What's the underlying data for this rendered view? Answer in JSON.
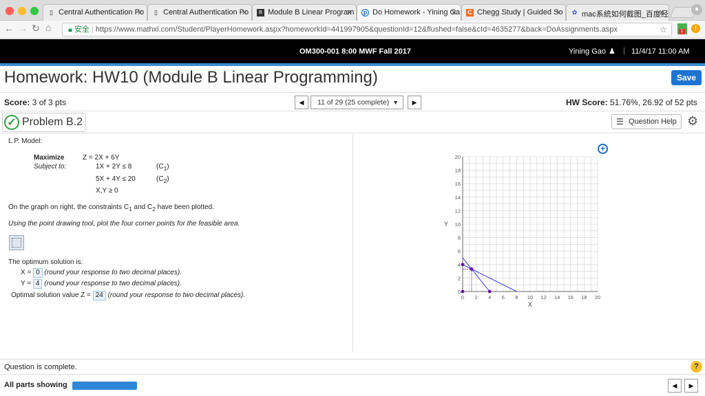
{
  "browser": {
    "tabs": [
      {
        "label": "Central Authentication Po",
        "icon": "page-icon"
      },
      {
        "label": "Central Authentication Po",
        "icon": "page-icon"
      },
      {
        "label": "Module B Linear Program",
        "icon": "module-icon"
      },
      {
        "label": "Do Homework - Yining Ga",
        "icon": "pearson-icon"
      },
      {
        "label": "Chegg Study | Guided So",
        "icon": "chegg-icon"
      },
      {
        "label": "mac系統如何截图_百度经验",
        "icon": "baidu-icon"
      }
    ],
    "secure_label": "安全",
    "url": "https://www.mathxl.com/Student/PlayerHomework.aspx?homeworkId=441997905&questionId=12&flushed=false&cId=4635277&back=DoAssignments.aspx",
    "ext_badge": "1"
  },
  "header": {
    "course": "OM300-001 8:00 MWF Fall 2017",
    "user": "Yining Gao",
    "datetime": "11/4/17 11:00 AM"
  },
  "page": {
    "title": "Homework: HW10 (Module B Linear Programming)",
    "save_label": "Save"
  },
  "score": {
    "label": "Score:",
    "value": "3 of 3 pts",
    "question_selector": "11 of 29 (25 complete)",
    "hw_label": "HW Score:",
    "hw_value": "51.76%, 26.92 of 52 pts"
  },
  "problem": {
    "title": "Problem B.2",
    "help_label": "Question Help"
  },
  "model": {
    "heading": "L.P. Model:",
    "maximize": "Maximize",
    "objective": "Z = 2X + 6Y",
    "subject_to": "Subject to:",
    "c1_expr": "1X + 2Y ≤ 8",
    "c1_label": "(C",
    "c1_sub": "1",
    "c2_expr": "5X + 4Y ≤ 20",
    "c2_label": "(C",
    "c2_sub": "2",
    "nonneg": "X,Y ≥ 0",
    "close_paren": ")"
  },
  "text": {
    "plotted_a": "On the graph on right, the constraints C",
    "plotted_sub1": "1",
    "plotted_b": " and C",
    "plotted_sub2": "2",
    "plotted_c": " have been plotted.",
    "instruction": "Using the point drawing tool, plot the four corner points for the feasible area.",
    "optimum": "The optimum solution is:",
    "x_label": "X =",
    "x_value": "0",
    "y_label": "Y =",
    "y_value": "4",
    "z_label": "Optimal solution value Z =",
    "z_value": "24",
    "round_hint": "(round your response to two decimal places)."
  },
  "chart_data": {
    "type": "line",
    "xlabel": "X",
    "ylabel": "Y",
    "xlim": [
      0,
      20
    ],
    "ylim": [
      0,
      20
    ],
    "xticks": [
      "0",
      "2",
      "4",
      "6",
      "8",
      "10",
      "12",
      "14",
      "16",
      "18",
      "20"
    ],
    "yticks": [
      "0",
      "2",
      "4",
      "6",
      "8",
      "10",
      "12",
      "14",
      "16",
      "18",
      "20"
    ],
    "grid": true,
    "series": [
      {
        "values": [
          [
            0,
            4
          ],
          [
            8,
            0
          ]
        ]
      },
      {
        "values": [
          [
            0,
            5
          ],
          [
            4,
            0
          ]
        ]
      }
    ],
    "points": [
      [
        0,
        0
      ],
      [
        0,
        4
      ],
      [
        1.33,
        3.33
      ],
      [
        4,
        0
      ]
    ],
    "colors": {
      "line": "#3a3ad6",
      "point": "#6a0dad"
    }
  },
  "footer": {
    "status": "Question is complete.",
    "parts": "All parts showing",
    "progress": 1.0
  },
  "colors": {
    "accent": "#1e74d1",
    "rule": "#3b8bd0",
    "check": "#2ea043"
  }
}
